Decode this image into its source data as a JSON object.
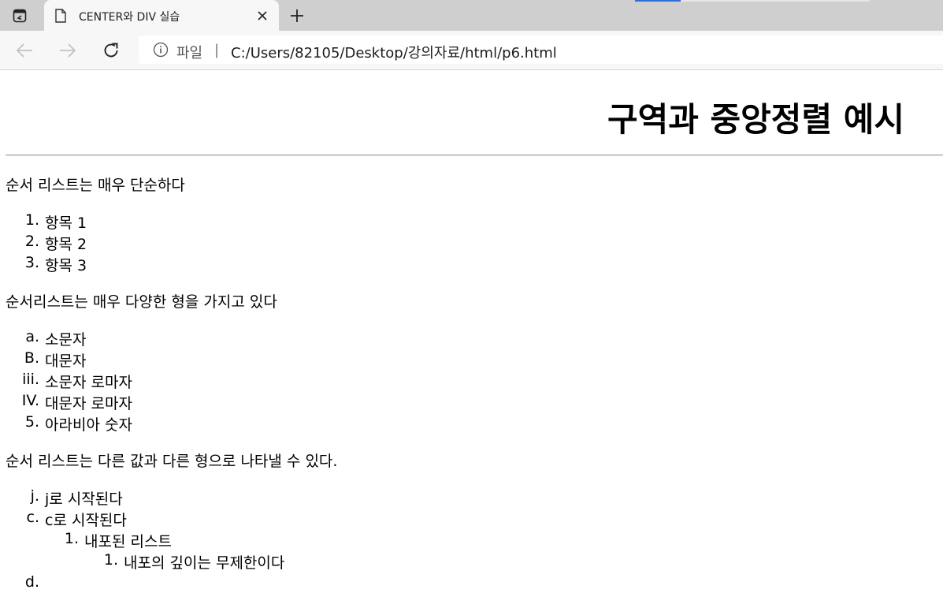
{
  "browser": {
    "tab": {
      "title": "CENTER와 DIV 실습",
      "icons": [
        "tab-actions-icon",
        "page-icon",
        "close-icon",
        "plus-icon"
      ]
    },
    "nav_icons": [
      "back-arrow-icon",
      "forward-arrow-icon",
      "reload-icon",
      "info-icon"
    ],
    "address": {
      "scheme_label": "파일",
      "separator": "|",
      "url": "C:/Users/82105/Desktop/강의자료/html/p6.html"
    }
  },
  "page": {
    "heading": "구역과 중앙정렬 예시",
    "sections": [
      {
        "intro": "순서 리스트는 매우 단순하다",
        "items": [
          {
            "marker": "1.",
            "text": "항목 1"
          },
          {
            "marker": "2.",
            "text": "항목 2"
          },
          {
            "marker": "3.",
            "text": "항목 3"
          }
        ]
      },
      {
        "intro": "순서리스트는 매우 다양한 형을 가지고 있다",
        "items": [
          {
            "marker": "a.",
            "text": "소문자"
          },
          {
            "marker": "B.",
            "text": "대문자"
          },
          {
            "marker": "iii.",
            "text": "소문자 로마자"
          },
          {
            "marker": "IV.",
            "text": "대문자 로마자"
          },
          {
            "marker": "5.",
            "text": "아라비아 숫자"
          }
        ]
      },
      {
        "intro": "순서 리스트는 다른 값과 다른 형으로 나타낼 수 있다.",
        "items": [
          {
            "marker": "j.",
            "text": "j로 시작된다"
          },
          {
            "marker": "c.",
            "text": "c로 시작된다"
          },
          {
            "marker": "1.",
            "text": "내포된 리스트"
          },
          {
            "marker": "1.",
            "text": "내포의 깊이는 무제한이다"
          },
          {
            "marker": "d.",
            "text": ""
          }
        ]
      }
    ]
  }
}
